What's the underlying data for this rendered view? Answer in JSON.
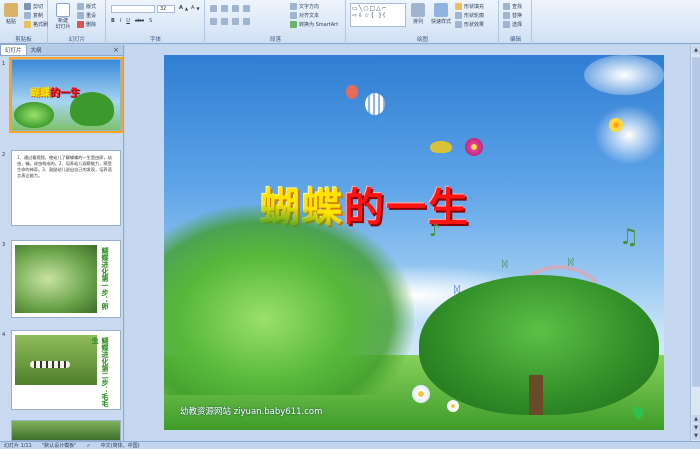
{
  "ribbon": {
    "clipboard": {
      "label": "剪贴板",
      "paste": "粘贴",
      "cut": "剪切",
      "copy": "复制",
      "format_painter": "格式刷"
    },
    "slides": {
      "label": "幻灯片",
      "new_slide": "新建\n幻灯片",
      "layout": "版式",
      "reset": "重设",
      "delete": "删除"
    },
    "font": {
      "label": "字体",
      "font_size": "32"
    },
    "paragraph": {
      "label": "段落",
      "text_direction": "文字方向",
      "align_text": "对齐文本",
      "smartart": "转换为 SmartArt"
    },
    "drawing": {
      "label": "绘图",
      "arrange": "排列",
      "quick_styles": "快速样式",
      "shape_fill": "形状填充",
      "shape_outline": "形状轮廓",
      "shape_effects": "形状效果"
    },
    "editing": {
      "label": "编辑",
      "find": "查找",
      "replace": "替换",
      "select": "选择"
    }
  },
  "panel": {
    "tab_slides": "幻灯片",
    "tab_outline": "大纲",
    "close": "×",
    "thumbs": [
      {
        "num": "1",
        "title_a": "蝴蝶",
        "title_b": "的一生"
      },
      {
        "num": "2",
        "text": "1、通过看视频，使幼儿了解蝴蝶的一生是由卵，幼虫，蛹，成虫构成的。2、培养幼儿观察能力，感受生命的神奇。3、鼓励幼儿说出自己的发现，培养语言表达能力。"
      },
      {
        "num": "3",
        "vtext": "蝴蝶进化第一步：卵"
      },
      {
        "num": "4",
        "vtext": "蝴蝶进化第二步：毛毛虫"
      }
    ]
  },
  "slide": {
    "title_part1": "蝴蝶",
    "title_part2": "的一生",
    "website": "幼教资源网站  ziyuan.baby611.com"
  },
  "status": {
    "slide_info": "幻灯片 1/11",
    "theme": "\"默认设计模板\"",
    "language": "中文(简体，中国)"
  }
}
